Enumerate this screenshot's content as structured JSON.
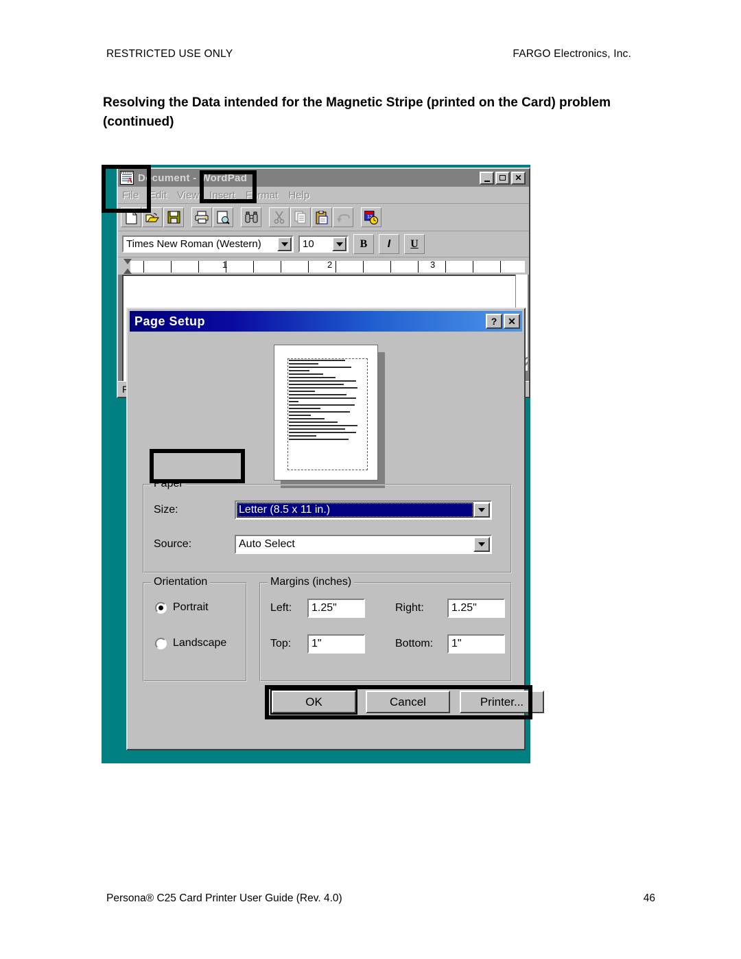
{
  "page": {
    "header_left": "RESTRICTED USE ONLY",
    "header_right": "FARGO Electronics, Inc.",
    "title": "Resolving the Data intended for the Magnetic Stripe (printed on the Card) problem (continued)",
    "footer_left": "Persona® C25 Card Printer User Guide (Rev. 4.0)",
    "footer_page": "46"
  },
  "colors": {
    "desktop": "#008080",
    "dialog_face": "#c0c0c0",
    "titlebar_active": "#000080",
    "titlebar_inactive": "#808080",
    "selection": "#000080",
    "highlight_box": "#000000"
  },
  "wordpad": {
    "title": "Document - WordPad",
    "title_part_1": "Document -",
    "title_part_2": "WordPad",
    "app_icon": "wordpad-document-icon",
    "window_buttons": [
      {
        "name": "minimize",
        "glyph": "_"
      },
      {
        "name": "maximize",
        "glyph": "□"
      },
      {
        "name": "close",
        "glyph": "✕"
      }
    ],
    "menu": [
      "File",
      "Edit",
      "View",
      "Insert",
      "Format",
      "Help"
    ],
    "toolbar_icons": [
      "new-document-icon",
      "open-folder-icon",
      "save-floppy-icon",
      "print-icon",
      "print-preview-icon",
      "find-binoculars-icon",
      "cut-scissors-icon",
      "copy-icon",
      "paste-icon",
      "undo-icon",
      "date-time-icon"
    ],
    "font_name": "Times New Roman (Western)",
    "font_size": "10",
    "format_buttons": [
      {
        "name": "bold",
        "label": "B"
      },
      {
        "name": "italic",
        "label": "I"
      },
      {
        "name": "underline",
        "label": "U"
      }
    ],
    "ruler_numbers": [
      "1",
      "2",
      "3"
    ],
    "status_text": "F"
  },
  "dialog": {
    "title": "Page Setup",
    "titlebar_buttons": [
      {
        "name": "help",
        "glyph": "?"
      },
      {
        "name": "close",
        "glyph": "✕"
      }
    ],
    "preview": {
      "name": "page-preview",
      "line_widths": [
        72,
        38,
        80,
        26,
        44,
        60,
        86,
        70,
        88,
        33,
        74,
        86,
        12,
        84,
        40,
        78,
        28,
        46,
        62,
        88,
        72,
        86,
        35,
        76
      ]
    },
    "paper": {
      "legend": "Paper",
      "size_label": "Size:",
      "size_value": "Letter (8.5 x 11 in.)",
      "size_selected": true,
      "source_label": "Source:",
      "source_value": "Auto Select"
    },
    "orientation": {
      "legend": "Orientation",
      "options": [
        {
          "label": "Portrait",
          "selected": true
        },
        {
          "label": "Landscape",
          "selected": false
        }
      ]
    },
    "margins": {
      "legend": "Margins (inches)",
      "fields": [
        {
          "label": "Left:",
          "value": "1.25\""
        },
        {
          "label": "Right:",
          "value": "1.25\""
        },
        {
          "label": "Top:",
          "value": "1\""
        },
        {
          "label": "Bottom:",
          "value": "1\""
        }
      ]
    },
    "buttons": [
      {
        "name": "ok-button",
        "label": "OK",
        "default": true
      },
      {
        "name": "cancel-button",
        "label": "Cancel",
        "default": false
      },
      {
        "name": "printer-button",
        "label": "Printer...",
        "default": false
      }
    ]
  }
}
